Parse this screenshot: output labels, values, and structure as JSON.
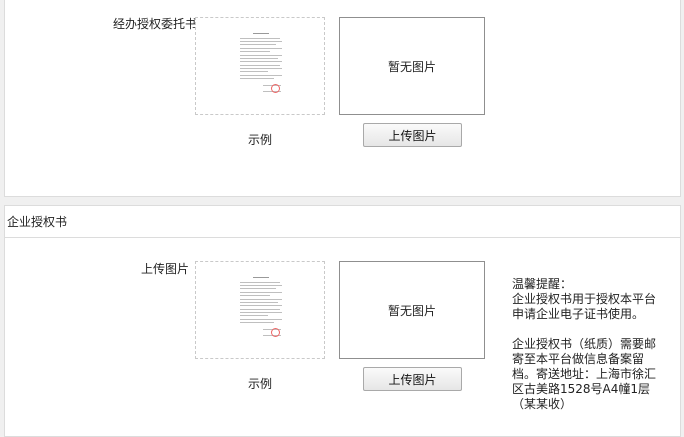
{
  "top_section": {
    "field_label": "经办授权委托书",
    "preview_placeholder": "暂无图片",
    "upload_button": "上传图片",
    "sample_caption": "示例"
  },
  "enterprise_section": {
    "header": "企业授权书",
    "field_label": "上传图片",
    "preview_placeholder": "暂无图片",
    "upload_button": "上传图片",
    "sample_caption": "示例",
    "tips": {
      "title": "温馨提醒：",
      "line1": "企业授权书用于授权本平台申请企业电子证书使用。",
      "line2": "企业授权书（纸质）需要邮寄至本平台做信息备案留档。寄送地址：上海市徐汇区古美路1528号A4幢1层（某某收）"
    }
  },
  "colors": {
    "page_bg": "#f0f0f0",
    "panel_border": "#dcdcdc",
    "stamp_red": "#e66666"
  }
}
